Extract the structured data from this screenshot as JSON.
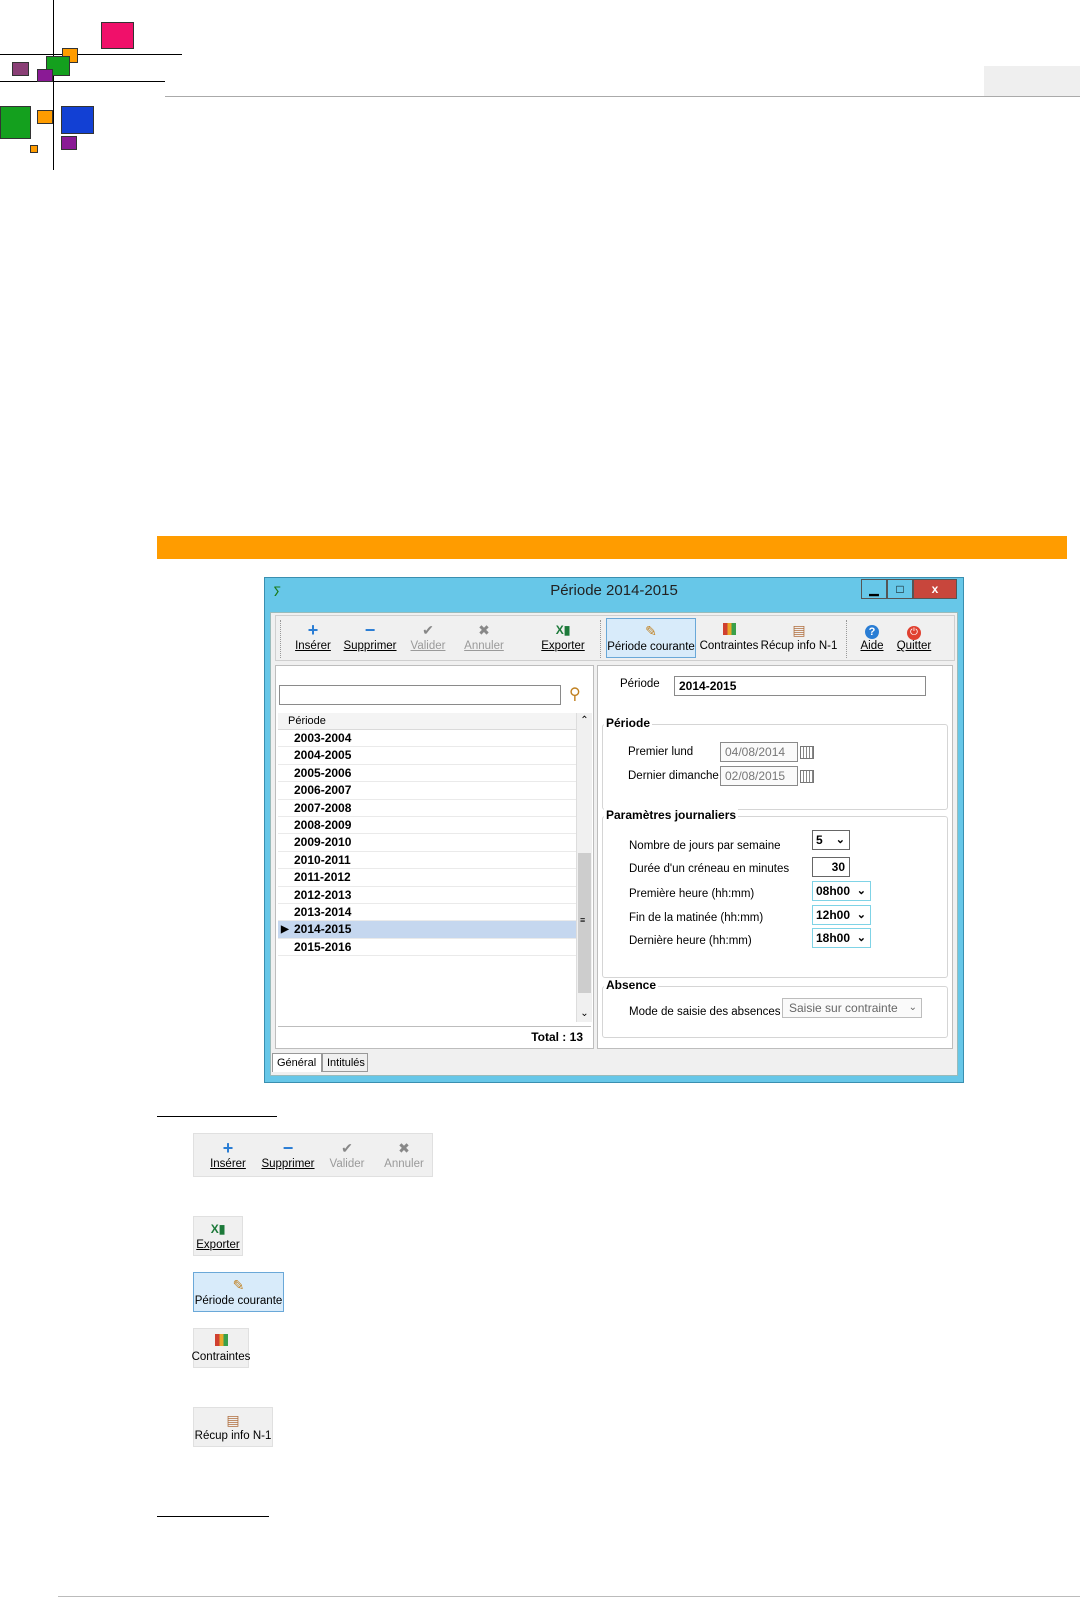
{
  "window": {
    "title": "Période 2014-2015",
    "controls": {
      "minimize": "▁",
      "maximize": "□",
      "close": "x"
    }
  },
  "toolbar": {
    "insert": "Insérer",
    "delete": "Supprimer",
    "validate": "Valider",
    "cancel": "Annuler",
    "export": "Exporter",
    "current_period": "Période courante",
    "constraints": "Contraintes",
    "recup": "Récup info N-1",
    "help": "Aide",
    "quit": "Quitter"
  },
  "list": {
    "search_value": "",
    "column_header": "Période",
    "rows": [
      "2003-2004",
      "2004-2005",
      "2005-2006",
      "2006-2007",
      "2007-2008",
      "2008-2009",
      "2009-2010",
      "2010-2011",
      "2011-2012",
      "2012-2013",
      "2013-2014",
      "2014-2015",
      "2015-2016"
    ],
    "selected": "2014-2015",
    "total": "Total : 13"
  },
  "form": {
    "periode_label": "Période",
    "periode_value": "2014-2015",
    "group_periode": "Période",
    "premier_lundi_label": "Premier lund",
    "premier_lundi_value": "04/08/2014",
    "dernier_dimanche_label": "Dernier dimanche",
    "dernier_dimanche_value": "02/08/2015",
    "group_params": "Paramètres journaliers",
    "jours_label": "Nombre de jours par semaine",
    "jours_value": "5",
    "duree_label": "Durée d'un créneau en minutes",
    "duree_value": "30",
    "premiere_label": "Première heure (hh:mm)",
    "premiere_value": "08h00",
    "fin_label": "Fin de la matinée (hh:mm)",
    "fin_value": "12h00",
    "derniere_label": "Dernière heure (hh:mm)",
    "derniere_value": "18h00",
    "group_absence": "Absence",
    "mode_label": "Mode de saisie des absences",
    "mode_value": "Saisie sur contrainte"
  },
  "tabs": [
    "Général",
    "Intitulés"
  ],
  "legend": {
    "insert": "Insérer",
    "delete": "Supprimer",
    "validate": "Valider",
    "cancel": "Annuler",
    "export": "Exporter",
    "current_period": "Période courante",
    "constraints": "Contraintes",
    "recup": "Récup info N-1"
  },
  "colors": {
    "orange_bar": "#ff9c00",
    "window_frame": "#67c7e8",
    "close_button": "#c8463c"
  }
}
